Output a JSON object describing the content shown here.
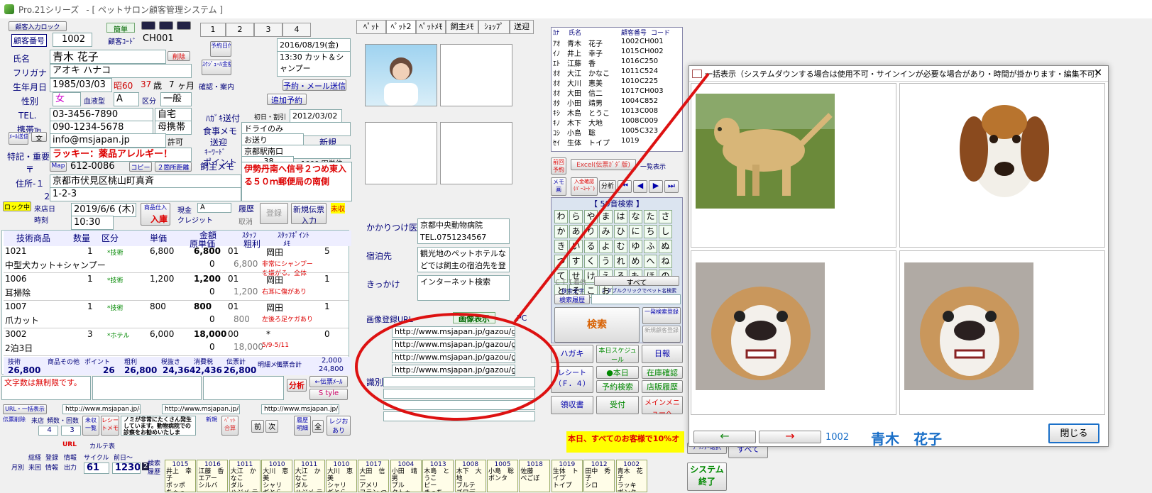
{
  "window": {
    "app": "Pro.21シリーズ",
    "title": "- [ ペットサロン顧客管理システム ]"
  },
  "customer": {
    "bulk_input_label": "顧客入力ロック",
    "simple": "簡単",
    "number_label": "顧客番号",
    "number": "1002",
    "code_label": "顧客ｺｰﾄﾞ",
    "code": "CH001",
    "name_label": "氏名",
    "name": "青木 花子",
    "delete": "削除",
    "kana_label": "フリガナ",
    "kana": "アオキ ハナコ",
    "dob_label": "生年月日",
    "dob": "1985/03/03",
    "era": "昭60",
    "age": "37",
    "age_unit": "歳",
    "months": "7",
    "month_unit": "ヶ月",
    "sex_label": "性別",
    "sex": "女",
    "blood_label": "血液型",
    "blood": "A",
    "class_label": "区分",
    "class": "一般",
    "tel_label": "TEL.",
    "tel": "03-3456-7890",
    "tel_type": "自宅",
    "mobile_label": "携帯℡",
    "mobile": "090-1234-5678",
    "mobile_type": "母携帯",
    "mail_btn": "ﾒｰﾙ送信",
    "text_btn": "文",
    "email": "info@msjapan.jp",
    "permit": "許可",
    "notes_label": "特記・重要",
    "notes": "ラッキー：薬品アレルギー！",
    "zip_label": "〒",
    "map": "Map",
    "zip": "612-0086",
    "copy": "コピー",
    "two_addr": "２箇所距離",
    "addr1_label": "住所-１",
    "addr1": "京都市伏見区桃山町真斉",
    "addr2_label": "２",
    "addr2": "1-2-3"
  },
  "schedule": {
    "tabs": [
      "1",
      "2",
      "3",
      "4"
    ],
    "reserve_date": "予約日付",
    "schedule_amount": "ｽｹｼﾞｭｰﾙ金額",
    "date": "2016/08/19(金)",
    "detail": "13:30 カット＆シャンプー",
    "confirm": "確認・案内",
    "reserve_mail": "予約・メール送信",
    "add_reserve": "追加予約",
    "dm_label": "ﾊｶﾞｷ送付",
    "first_label": "初日・割引",
    "dm_date": "2012/03/02",
    "meal_label": "食事メモ",
    "meal": "ドライのみ",
    "send_label": "送迎",
    "send": "お送り",
    "new_label": "新規",
    "keyword_label": "ｷｰﾜｰﾄﾞ",
    "keyword": "京都駅南口",
    "point_label": "ポイント",
    "point": "38",
    "point_unit": "1000 円単位",
    "owner_memo_label": "飼主メモ",
    "owner_memo": "伊勢丹南へ信号２つめ東入る５０ｍ郵便局の南側"
  },
  "visit": {
    "lock": "ロック中",
    "store_label": "来店日",
    "hours": "時刻",
    "date": "2019/6/6 (木)",
    "time": "10:30",
    "stock_in": "商品仕入",
    "arrival": "入庫",
    "cash": "現金",
    "cash_sel": "A",
    "credit": "クレジット",
    "history": "履歴",
    "cancel": "取消",
    "register": "登録",
    "new_slip": "新規伝票入力",
    "unpaid": "未収"
  },
  "line_headers": [
    "技術商品",
    "数量",
    "区分",
    "単価",
    "金額",
    "原単価",
    "ｽﾀｯﾌ",
    "粗利",
    "ｽﾀｯﾌﾎﾟｲﾝﾄ",
    "ﾒﾓ"
  ],
  "lines": [
    {
      "code": "1021",
      "qty": "1",
      "type": "*技術",
      "price": "6,800",
      "amount": "6,800",
      "staff": "01",
      "staff_name": "岡田",
      "pt": "5",
      "name": "中型犬カット+シャンプー",
      "cost": "0",
      "profit": "6,800",
      "memo": "非常にシャンプーを嫌がる。全体"
    },
    {
      "code": "1006",
      "qty": "1",
      "type": "*技術",
      "price": "1,200",
      "amount": "1,200",
      "staff": "01",
      "staff_name": "岡田",
      "pt": "1",
      "name": "耳掃除",
      "cost": "0",
      "profit": "1,200",
      "memo": "右耳に傷があり"
    },
    {
      "code": "1007",
      "qty": "1",
      "type": "*技術",
      "price": "800",
      "amount": "800",
      "staff": "01",
      "staff_name": "岡田",
      "pt": "1",
      "name": "爪カット",
      "cost": "0",
      "profit": "800",
      "memo": "左後ろ足ケガあり"
    },
    {
      "code": "3002",
      "qty": "3",
      "type": "*ホテル",
      "price": "6,000",
      "amount": "18,000",
      "staff": "00",
      "staff_name": "*",
      "pt": "0",
      "name": "2泊3日",
      "cost": "0",
      "profit": "18,000",
      "memo": "5/9-5/11"
    }
  ],
  "totals": {
    "labels": [
      "技術",
      "商品その他",
      "ポイント",
      "粗利",
      "税抜き",
      "消費税",
      "伝票計"
    ],
    "values": [
      "26,800",
      "",
      "26",
      "26,800",
      "24,364",
      "2,436",
      "26,800"
    ],
    "detail": "明細メモ",
    "slip_total": "伝票合計",
    "paid": "2,000",
    "balance": "24,800"
  },
  "free_text": {
    "placeholder": "文字数は無制限です。",
    "analysis": "分析",
    "slip_mail": "←伝票ﾒｰﾙ",
    "style": "S tyle"
  },
  "url_row": {
    "label": "URL・一括表示",
    "urls": [
      "http://www.msjapan.jp/ga",
      "http://www.msjapan.jp/ga",
      "http://www.msjapan.jp/ga"
    ]
  },
  "visit_stats": {
    "slip_clear": "伝票削除",
    "visit_count": "来店",
    "times_label": "頻数・回数",
    "unpaid": "未収一覧",
    "receipt": "レシートメモ",
    "notice": "ノミが非常にたくさん発生しています。動物病院での診察をお勧めいたしま",
    "new": "新規",
    "pet_merge": "ﾍﾟｯﾄ合算",
    "prev": "前",
    "next": "次",
    "history": "履歴明細",
    "all": "全",
    "reji": "レジおあり",
    "count1": "4",
    "count2": "3"
  },
  "footer": {
    "monthly": "月別",
    "total": "総経",
    "register": "登録",
    "info": "情報",
    "visit": "来回",
    "reg_info": "情報",
    "output": "出力",
    "cycle": "サイクル",
    "prev_days": "前日～",
    "url": "URL",
    "karte": "カルテ表",
    "cycle_val": "61",
    "days_val": "1230",
    "page": "2",
    "search": "検索",
    "history": "履歴"
  },
  "pet_tabs": [
    "ﾍﾟｯﾄ",
    "ﾍﾟｯﾄ2",
    "ﾍﾟｯﾄﾒﾓ",
    "飼主ﾒﾓ",
    "ｼｮｯﾌﾟ",
    "送迎"
  ],
  "pet": {
    "vet_label": "かかりつけ医",
    "vet": "京都中央動物病院 TEL.0751234567",
    "stay_label": "宿泊先",
    "stay": "観光地のペットホテルなどでは飼主の宿泊先を登録し",
    "trigger_label": "きっかけ",
    "trigger": "インターネット検索",
    "img_url_label": "画像登録URL",
    "img_show": "画像表示",
    "pc": "PC",
    "img_urls": [
      "http://www.msjapan.jp/gazou/g",
      "http://www.msjapan.jp/gazou/g",
      "http://www.msjapan.jp/gazou/g",
      "http://www.msjapan.jp/gazou/g"
    ],
    "identify": "識別"
  },
  "customer_list": {
    "kana_h": "ｶﾅ",
    "name_h": "氏名",
    "num_h": "顧客番号",
    "code_h": "コード",
    "rows": [
      {
        "k": "ｱｵ",
        "n": "青木　花子",
        "no": "1002",
        "c": "CH001"
      },
      {
        "k": "ｲﾉ",
        "n": "井上　幸子",
        "no": "1015",
        "c": "CH002"
      },
      {
        "k": "ｴﾄ",
        "n": "江藤　香",
        "no": "1016",
        "c": "C250"
      },
      {
        "k": "ｵｵ",
        "n": "大江　かなこ",
        "no": "1011",
        "c": "C524"
      },
      {
        "k": "ｵｵ",
        "n": "大川　恵美",
        "no": "1010",
        "c": "C225"
      },
      {
        "k": "ｵｵ",
        "n": "大田　信二",
        "no": "1017",
        "c": "CH003"
      },
      {
        "k": "ｵﾀ",
        "n": "小田　靖男",
        "no": "1004",
        "c": "C852"
      },
      {
        "k": "ｷｼ",
        "n": "木島　とうこ",
        "no": "1013",
        "c": "C008"
      },
      {
        "k": "ｷﾉ",
        "n": "木下　大地",
        "no": "1008",
        "c": "C009"
      },
      {
        "k": "ｺｼ",
        "n": "小島　聡",
        "no": "1005",
        "c": "C323"
      },
      {
        "k": "ｾｲ",
        "n": "生体　トイプ",
        "no": "1019",
        "c": ""
      }
    ]
  },
  "search": {
    "prev_reserve": "前回予約",
    "excel": "Excel(伝票ｶﾞﾀﾞ版)",
    "bulk_show": "一覧表示",
    "memo": "メモ画",
    "input_confirm": "入金確認(ﾊﾞｰｺｰﾄﾞ)",
    "analysis": "分析",
    "fifty_title": "【 50音検索 】",
    "kana": [
      "わ",
      "ら",
      "や",
      "ま",
      "は",
      "な",
      "た",
      "さ",
      "か",
      "あ",
      "り",
      "み",
      "ひ",
      "に",
      "ち",
      "し",
      "き",
      "い",
      "る",
      "よ",
      "む",
      "ゆ",
      "ふ",
      "ぬ",
      "つ",
      "す",
      "く",
      "う",
      "れ",
      "め",
      "へ",
      "ね",
      "て",
      "せ",
      "け",
      "え",
      "ろ",
      "も",
      "ほ",
      "の",
      "と",
      "そ",
      "こ",
      "お"
    ],
    "cti": "ＣＴＩ着信",
    "all": "すべて",
    "search_label": "検索文字",
    "dblclick": "↓ ダブルクリックでペット名検索",
    "history": "検索履歴",
    "search": "検索",
    "one_search": "一発検索登録",
    "new_reg": "新規顧客登録"
  },
  "actions": {
    "postcard": "ハガキ",
    "today_schedule": "本日スケジュール",
    "daily": "日報",
    "receipt": "レシート（Ｆ．４）",
    "today": "●本日",
    "reserve_search": "予約検索",
    "stock_confirm": "在庫確認",
    "store_history": "店販履歴",
    "notice": "案内",
    "receipt_out": "領収書",
    "reception": "受付",
    "main_menu": "メインメニューへ",
    "ticker": "本日、すべてのお客様で10%オ",
    "printer": "ﾌﾟﾘﾝﾀｰ選択",
    "all": "すべて",
    "system_end": "システム終了"
  },
  "cards": [
    {
      "no": "1015",
      "a": "井上　幸子",
      "b": "ポッポ",
      "c": "ちゃっ"
    },
    {
      "no": "1016",
      "a": "江藤　香",
      "b": "エアー",
      "c": "シルバ"
    },
    {
      "no": "1011",
      "a": "大江　かなこ",
      "b": "ダル",
      "c": "ハジメ テトラ"
    },
    {
      "no": "1010",
      "a": "大川　恵美",
      "b": "シャリ",
      "c": "ギとら"
    },
    {
      "no": "1011",
      "a": "大江　かなこ",
      "b": "ダル",
      "c": "ハジメ テトラ"
    },
    {
      "no": "1010",
      "a": "大川　恵美",
      "b": "シャリ",
      "c": "ギとら"
    },
    {
      "no": "1017",
      "a": "大田　信二",
      "b": "アメリ",
      "c": "フラン つる"
    },
    {
      "no": "1004",
      "a": "小田　靖男",
      "b": "プル",
      "c": "タトゥ"
    },
    {
      "no": "1013",
      "a": "木島　とうこ",
      "b": "ピー",
      "c": "きっち"
    },
    {
      "no": "1008",
      "a": "木下　大地",
      "b": "ブルテ",
      "c": "ズロデ"
    },
    {
      "no": "1005",
      "a": "小島　聡",
      "b": "ポンタ",
      "c": ""
    },
    {
      "no": "1018",
      "a": "佐藤",
      "b": "べごぼ",
      "c": ""
    },
    {
      "no": "1019",
      "a": "生体　トイプ",
      "b": "トイプ",
      "c": ""
    },
    {
      "no": "1012",
      "a": "田中　秀子",
      "b": "シロ",
      "c": ""
    },
    {
      "no": "1002",
      "a": "青木　花子",
      "b": "ラッキ",
      "c": "ポンタ"
    }
  ],
  "modal": {
    "title": "一括表示（システムダウンする場合は使用不可・サインインが必要な場合があり・時間が掛かります・編集不可）",
    "prev": "←",
    "next": "→",
    "number": "1002",
    "name": "青木　花子",
    "close": "閉じる",
    "images": [
      "labrador-photo",
      "beagle-puppy-photo",
      "bulldog-photo",
      "bulldog-photo"
    ]
  },
  "colors": {
    "accent_red": "#dd0000",
    "navy": "#00007a",
    "green": "#006600",
    "modal_name": "#1a6fc8"
  }
}
